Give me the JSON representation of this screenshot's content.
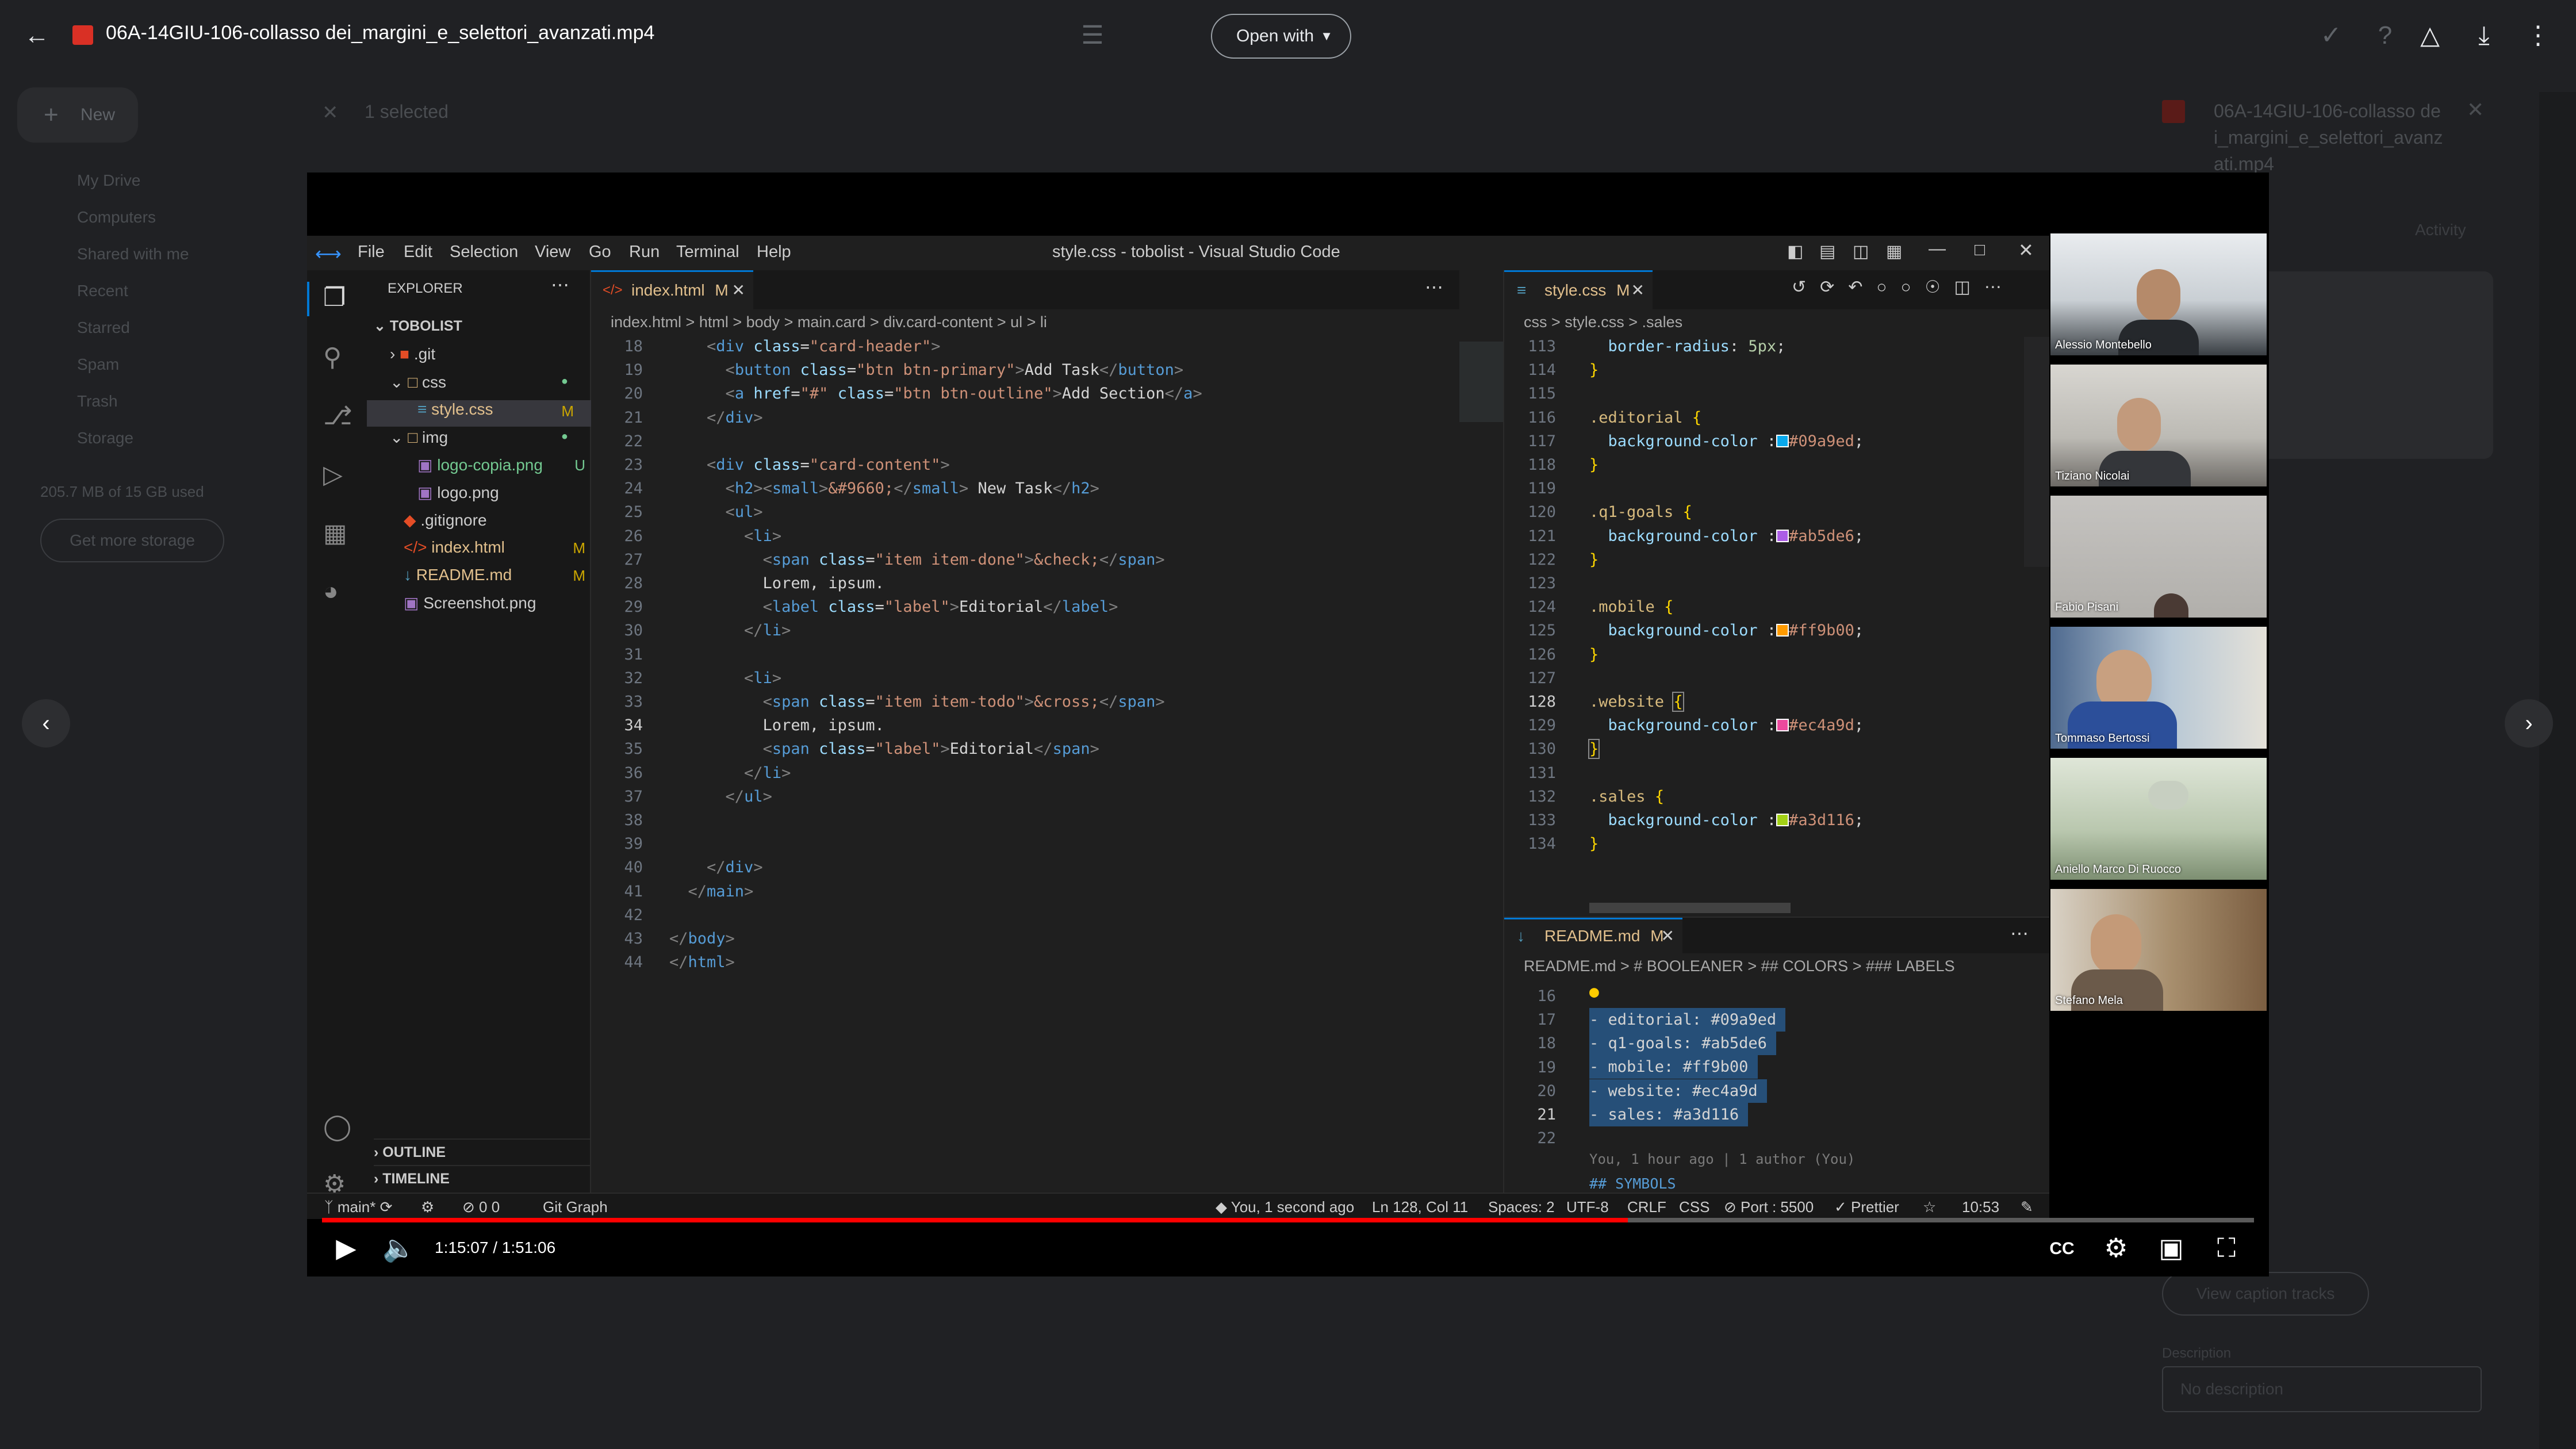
{
  "drive": {
    "file_title": "06A-14GIU-106-collasso dei_margini_e_selettori_avanzati.mp4",
    "open_with_label": "Open with",
    "new_label": "New",
    "selected_label": "1 selected",
    "sidebar_items": [
      "My Drive",
      "Computers",
      "Shared with me",
      "Recent",
      "Starred",
      "Spam",
      "Trash",
      "Storage"
    ],
    "storage_used": "205.7 MB of 15 GB used",
    "get_storage_label": "Get more storage",
    "details_title": "06A-14GIU-106-collasso dei_margini_e_selettori_avanzati.mp4",
    "activity_tab": "Activity",
    "view_caption_tracks": "View caption tracks",
    "description_label": "Description",
    "description_placeholder": "No description"
  },
  "vscode": {
    "window_title": "style.css - tobolist - Visual Studio Code",
    "menu": [
      "File",
      "Edit",
      "Selection",
      "View",
      "Go",
      "Run",
      "Terminal",
      "Help"
    ],
    "explorer_title": "EXPLORER",
    "project": "TOBOLIST",
    "tree": [
      {
        "label": ".git",
        "badge": ""
      },
      {
        "label": "css",
        "badge": ""
      },
      {
        "label": "style.css",
        "badge": "M"
      },
      {
        "label": "img",
        "badge": ""
      },
      {
        "label": "logo-copia.png",
        "badge": "U"
      },
      {
        "label": "logo.png",
        "badge": ""
      },
      {
        "label": ".gitignore",
        "badge": ""
      },
      {
        "label": "index.html",
        "badge": "M"
      },
      {
        "label": "README.md",
        "badge": "M"
      },
      {
        "label": "Screenshot.png",
        "badge": ""
      }
    ],
    "outline_label": "OUTLINE",
    "timeline_label": "TIMELINE",
    "left_tab": "index.html",
    "left_tab_badge": "M",
    "left_crumbs": "index.html  >  html  >  body  >  main.card  >  div.card-content  >  ul  >  li",
    "right_tab": "style.css",
    "right_tab_badge": "M",
    "right_crumbs": "css  >  style.css  >  .sales",
    "bottom_tab": "README.md",
    "bottom_tab_badge": "M",
    "bottom_crumbs": "README.md  >  # BOOLEANER  >  ## COLORS  >  ### LABELS",
    "blame": "You, 1 hour ago | 1 author (You)",
    "status": {
      "branch": "main*",
      "problems": "0  0",
      "git_graph": "Git Graph",
      "blame": "You, 1 second ago",
      "position": "Ln 128, Col 11",
      "spaces": "Spaces: 2",
      "encoding": "UTF-8",
      "eol": "CRLF",
      "lang": "CSS",
      "port": "Port : 5500",
      "prettier": "Prettier",
      "clock": "10:53"
    },
    "colors": {
      "editorial": "#09a9ed",
      "q1goals": "#ab5de6",
      "mobile": "#ff9b00",
      "website": "#ec4a9d",
      "sales": "#a3d116"
    }
  },
  "participants": [
    "Alessio Montebello",
    "Tiziano Nicolai",
    "Fabio Pisani",
    "Tommaso Bertossi",
    "Aniello Marco Di Ruocco",
    "Stefano Mela"
  ],
  "player": {
    "current": "1:15:07",
    "total": "1:51:06",
    "timecode": "1:15:07 / 1:51:06",
    "progress_fraction": 0.676
  }
}
